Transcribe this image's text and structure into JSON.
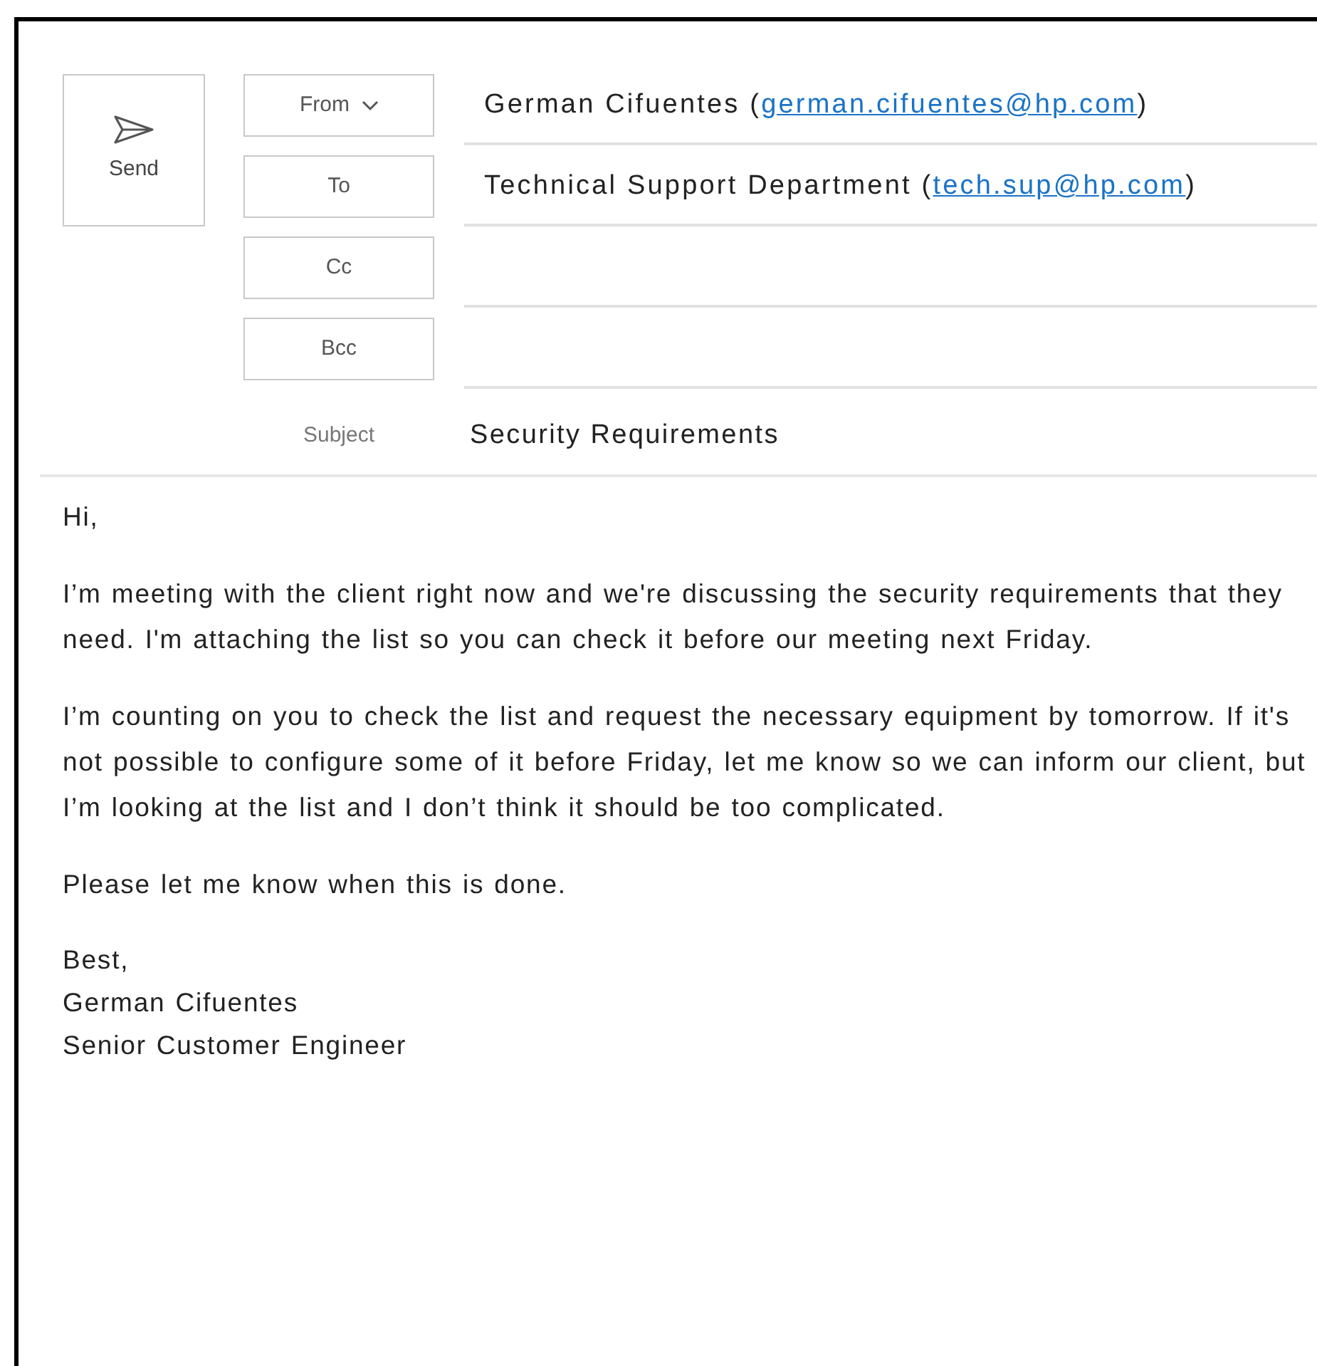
{
  "send_button": {
    "label": "Send"
  },
  "fields": [
    {
      "kind": "dropdown",
      "label": "From",
      "name": "German Cifuentes (",
      "email": "german.cifuentes@hp.com",
      "after": ")"
    },
    {
      "kind": "button",
      "label": "To",
      "name": "Technical Support Department (",
      "email": "tech.sup@hp.com",
      "after": ")"
    },
    {
      "kind": "button",
      "label": "Cc"
    },
    {
      "kind": "button",
      "label": "Bcc"
    }
  ],
  "subject": {
    "label": "Subject",
    "value": "Security Requirements"
  },
  "body": {
    "paragraphs": [
      "Hi,",
      "I’m meeting with the client right now and we're discussing the security requirements that they need. I'm attaching the list so you can check it before our meeting next Friday.",
      "I’m counting on you to check the list and request the necessary equipment by tomorrow. If it's not possible to configure some of it before Friday, let me know so we can inform our client, but I’m looking at the list and I don’t think it should be too complicated.",
      "Please let me know when this is done."
    ],
    "signature": [
      "Best,",
      "German Cifuentes",
      "Senior Customer Engineer"
    ]
  }
}
